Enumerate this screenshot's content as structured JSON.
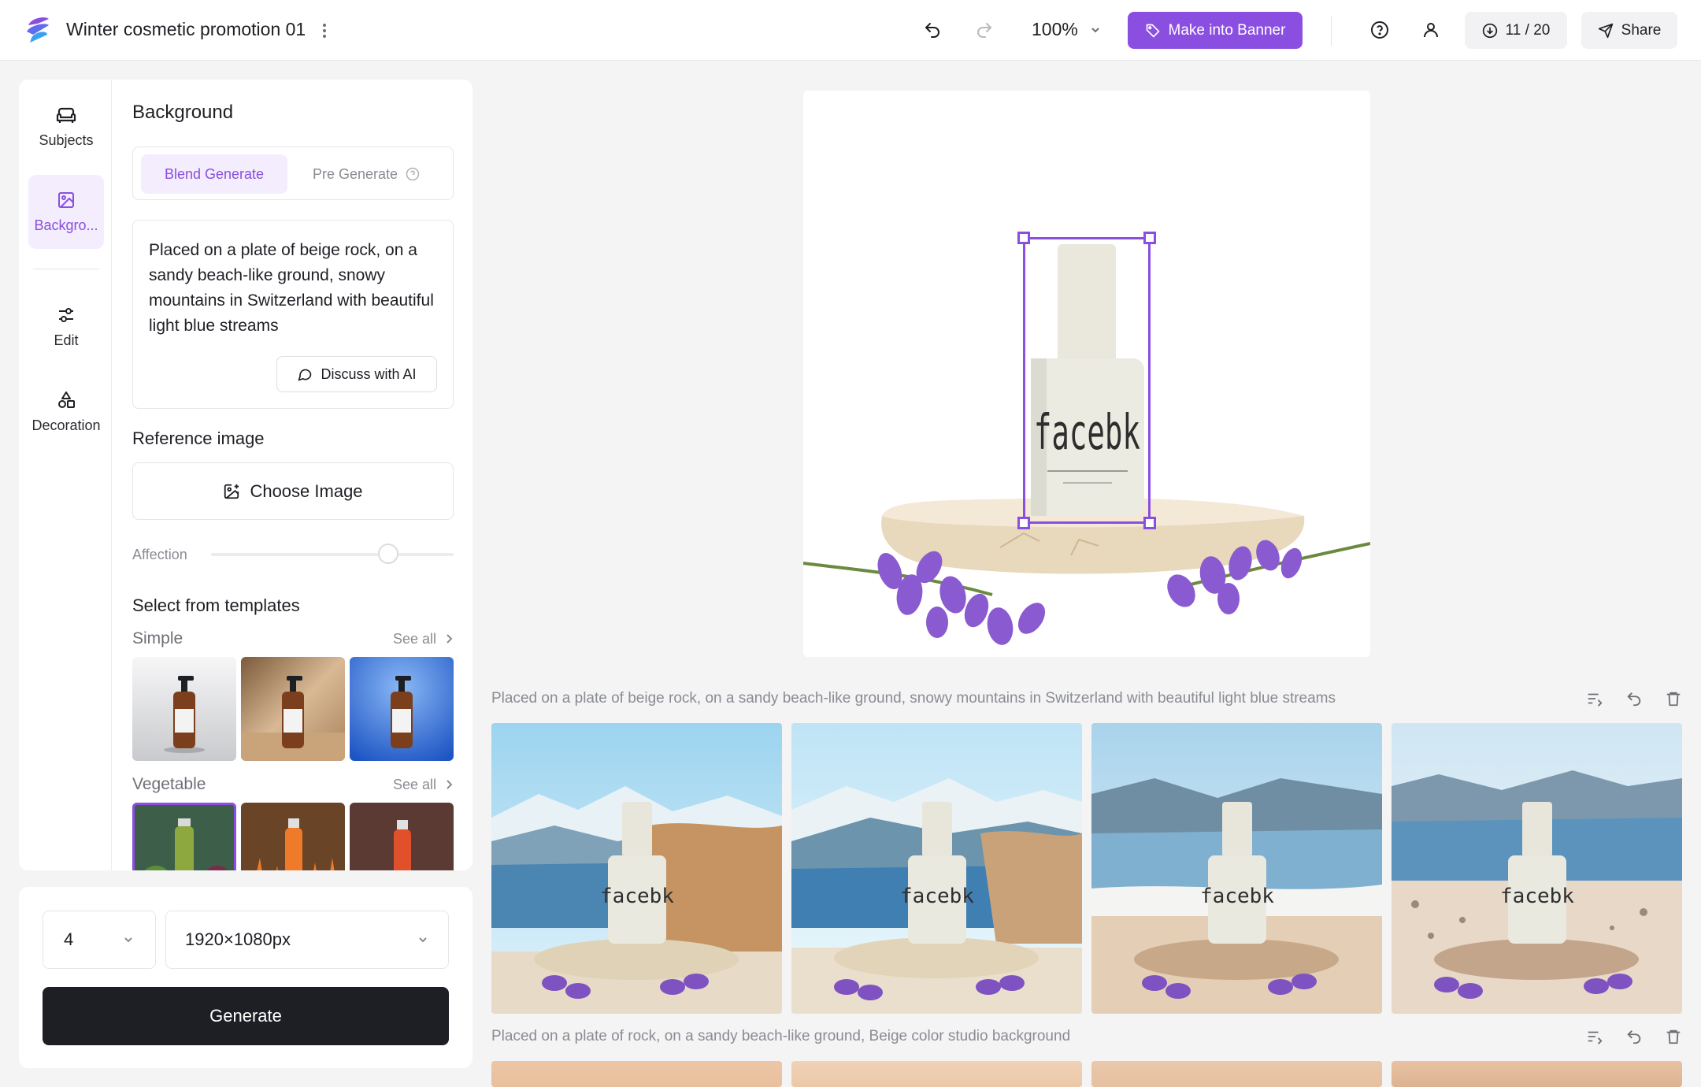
{
  "header": {
    "title": "Winter cosmetic promotion 01",
    "zoom": "100%",
    "make_banner_label": "Make into Banner",
    "credits": "11 / 20",
    "share_label": "Share"
  },
  "nav": {
    "items": [
      {
        "label": "Subjects",
        "icon": "sofa-icon"
      },
      {
        "label": "Backgro...",
        "icon": "image-icon"
      },
      {
        "label": "Edit",
        "icon": "sliders-icon"
      },
      {
        "label": "Decoration",
        "icon": "shapes-icon"
      }
    ],
    "active": "Backgro..."
  },
  "background": {
    "title": "Background",
    "mode_blend": "Blend Generate",
    "mode_pre": "Pre Generate",
    "prompt": "Placed on a plate of beige rock, on a sandy beach-like ground, snowy mountains in Switzerland with beautiful light blue streams",
    "discuss_label": "Discuss with AI",
    "reference_title": "Reference image",
    "choose_label": "Choose Image",
    "affection_label": "Affection",
    "affection_value": 0.73,
    "templates_title": "Select from templates",
    "see_all": "See all",
    "categories": [
      {
        "name": "Simple"
      },
      {
        "name": "Vegetable"
      }
    ]
  },
  "generate": {
    "count": "4",
    "size": "1920×1080px",
    "button_label": "Generate"
  },
  "canvas": {
    "product_text": "facebk"
  },
  "history": [
    {
      "prompt": "Placed on a plate of beige rock, on a sandy beach-like ground, snowy mountains in Switzerland with beautiful light blue streams"
    },
    {
      "prompt": "Placed on a plate of rock, on a sandy beach-like ground, Beige color studio background"
    }
  ],
  "colors": {
    "accent": "#8a4fe0",
    "dark_button": "#1d1f24"
  }
}
